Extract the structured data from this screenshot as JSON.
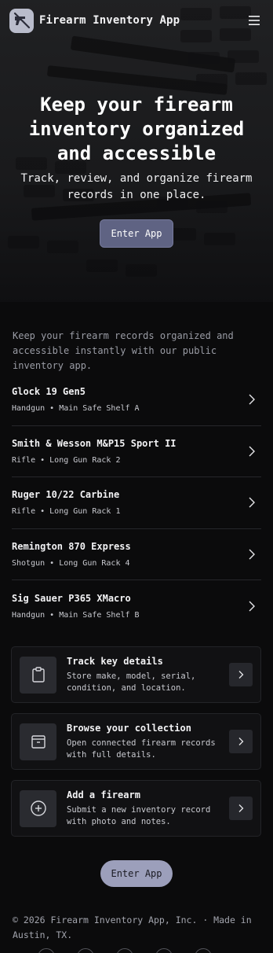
{
  "header": {
    "app_title": "Firearm Inventory App",
    "logo_icon": "firearm-slash-icon",
    "menu_icon": "hamburger-menu-icon"
  },
  "hero": {
    "title": "Keep your firearm inventory organized and accessible",
    "subtitle": "Track, review, and organize firearm records in one place.",
    "button_label": "Enter App"
  },
  "intro": "Keep your firearm records organized and accessible instantly with our public inventory app.",
  "items": [
    {
      "name": "Glock 19 Gen5",
      "meta": "Handgun • Main Safe Shelf A"
    },
    {
      "name": "Smith & Wesson M&P15 Sport II",
      "meta": "Rifle • Long Gun Rack 2"
    },
    {
      "name": "Ruger 10/22 Carbine",
      "meta": "Rifle • Long Gun Rack 1"
    },
    {
      "name": "Remington 870 Express",
      "meta": "Shotgun • Long Gun Rack 4"
    },
    {
      "name": "Sig Sauer P365 XMacro",
      "meta": "Handgun • Main Safe Shelf B"
    }
  ],
  "features": [
    {
      "title": "Track key details",
      "desc": "Store make, model, serial, condition, and location.",
      "icon": "clipboard-icon"
    },
    {
      "title": "Browse your collection",
      "desc": "Open connected firearm records with full details.",
      "icon": "archive-box-icon"
    },
    {
      "title": "Add a firearm",
      "desc": "Submit a new inventory record with photo and notes.",
      "icon": "plus-circle-icon"
    }
  ],
  "cta_label": "Enter App",
  "footer": "© 2026 Firearm Inventory App, Inc. · Made in Austin, TX.",
  "colors": {
    "primary_button": "#5f6383",
    "secondary_button": "#9c9fbb",
    "background": "#0b0b0c",
    "card_bg": "#111113"
  }
}
